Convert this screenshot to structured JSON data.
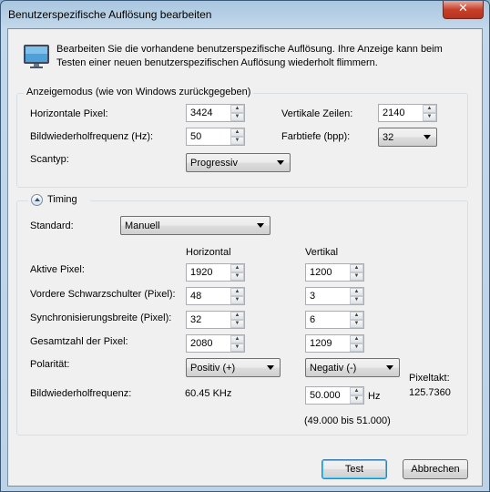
{
  "window": {
    "title": "Benutzerspezifische Auflösung bearbeiten",
    "close_glyph": "✕"
  },
  "header": {
    "icon": "monitor-icon",
    "text": "Bearbeiten Sie die vorhandene benutzerspezifische Auflösung. Ihre Anzeige kann beim Testen einer neuen benutzerspezifischen Auflösung wiederholt flimmern."
  },
  "display_mode": {
    "group_label": "Anzeigemodus (wie von Windows zurückgegeben)",
    "horizontal_pixels": {
      "label": "Horizontale Pixel:",
      "value": "3424"
    },
    "vertical_lines": {
      "label": "Vertikale Zeilen:",
      "value": "2140"
    },
    "refresh_rate": {
      "label": "Bildwiederholfrequenz (Hz):",
      "value": "50"
    },
    "color_depth": {
      "label": "Farbtiefe (bpp):",
      "value": "32"
    },
    "scan_type": {
      "label": "Scantyp:",
      "value": "Progressiv"
    }
  },
  "timing": {
    "group_label": "Timing",
    "standard": {
      "label": "Standard:",
      "value": "Manuell"
    },
    "col_horizontal": "Horizontal",
    "col_vertical": "Vertikal",
    "rows": [
      {
        "label": "Aktive Pixel:",
        "h": "1920",
        "v": "1200"
      },
      {
        "label": "Vordere Schwarzschulter (Pixel):",
        "h": "48",
        "v": "3"
      },
      {
        "label": "Synchronisierungsbreite (Pixel):",
        "h": "32",
        "v": "6"
      },
      {
        "label": "Gesamtzahl der Pixel:",
        "h": "2080",
        "v": "1209"
      }
    ],
    "polarity": {
      "label": "Polarität:",
      "h": "Positiv (+)",
      "v": "Negativ (-)"
    },
    "refresh": {
      "label": "Bildwiederholfrequenz:",
      "h_value": "60.45 KHz",
      "v_value": "50.000",
      "unit": "Hz",
      "range": "(49.000 bis 51.000)"
    },
    "pixel_clock": {
      "label": "Pixeltakt:",
      "value": "125.7360"
    }
  },
  "buttons": {
    "test": "Test",
    "cancel": "Abbrechen"
  }
}
